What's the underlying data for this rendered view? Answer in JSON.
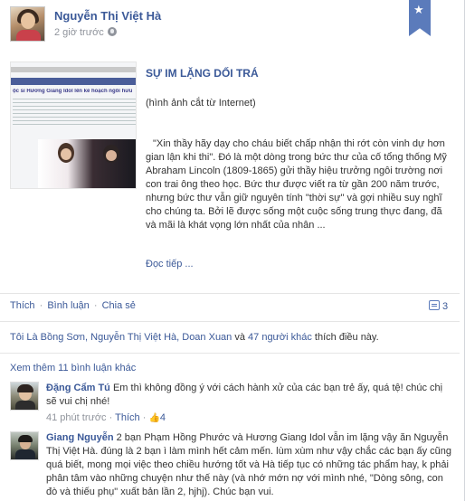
{
  "post": {
    "author": "Nguyễn Thị Việt Hà",
    "time": "2 giờ trước",
    "privacy_icon": "globe-icon",
    "bookmark_icon": "star-icon"
  },
  "article": {
    "thumbnail_headline": "ộc sĩ Hương Giang Idol lên kế hoạch ngôi hưu",
    "title": "SỰ IM LẶNG DỐI TRÁ",
    "caption": "(hình ảnh cắt từ Internet)",
    "excerpt": "\"Xin thầy hãy dạy cho cháu biết chấp nhận thi rớt còn vinh dự hơn gian lận khi thi\". Đó là một dòng trong bức thư của cố tổng thống Mỹ Abraham Lincoln (1809-1865) gửi thầy hiệu trưởng ngôi trường nơi con trai ông theo học. Bức thư được viết ra từ gần 200 năm trước, nhưng bức thư vẫn giữ nguyên tính \"thời sự\" và gợi nhiều suy nghĩ cho chúng ta. Bởi lẽ được sống một cuộc sống trung thực đang, đã và mãi là khát vọng lớn nhất của nhân ...",
    "read_more": "Đọc tiếp ..."
  },
  "actions": {
    "like": "Thích",
    "comment": "Bình luận",
    "share": "Chia sẻ",
    "separator": "·",
    "comment_count": "3"
  },
  "likes_summary": {
    "names": "Tôi Là Bồng Sơn, Nguyễn Thị Việt Hà, Doan Xuan",
    "connector": " và ",
    "others": "47 người khác",
    "suffix": " thích điều này."
  },
  "more_comments": "Xem thêm 11 bình luận khác",
  "comments": [
    {
      "name": "Đặng Cẩm Tú",
      "text": "Em thì không đồng ý với cách hành xử của các bạn trẻ ấy, quá tệ! chúc chị sẽ vui chị nhé!",
      "time": "41 phút trước",
      "like": "Thích",
      "like_count": "4"
    },
    {
      "name": "Giang Nguyễn",
      "text": "2 bạn Phạm Hồng Phước và Hương Giang Idol vẫn im lặng vậy ăn Nguyễn Thị Việt Hà. đúng là 2 bạn ì làm mình hết cảm mến. lùm xùm như vậy chắc các bạn ấy cũng quá biết, mong mọi việc theo chiều hướng tốt và Hà tiếp tục có những tác phẩm hay, k phải phân tâm vào những chuyện như thế này (và nhớ mớn nợ với mình nhé, \"Dòng sông, con đò và thiếu phụ\" xuất bản lần 2, hjhj). Chúc bạn vui."
    }
  ]
}
